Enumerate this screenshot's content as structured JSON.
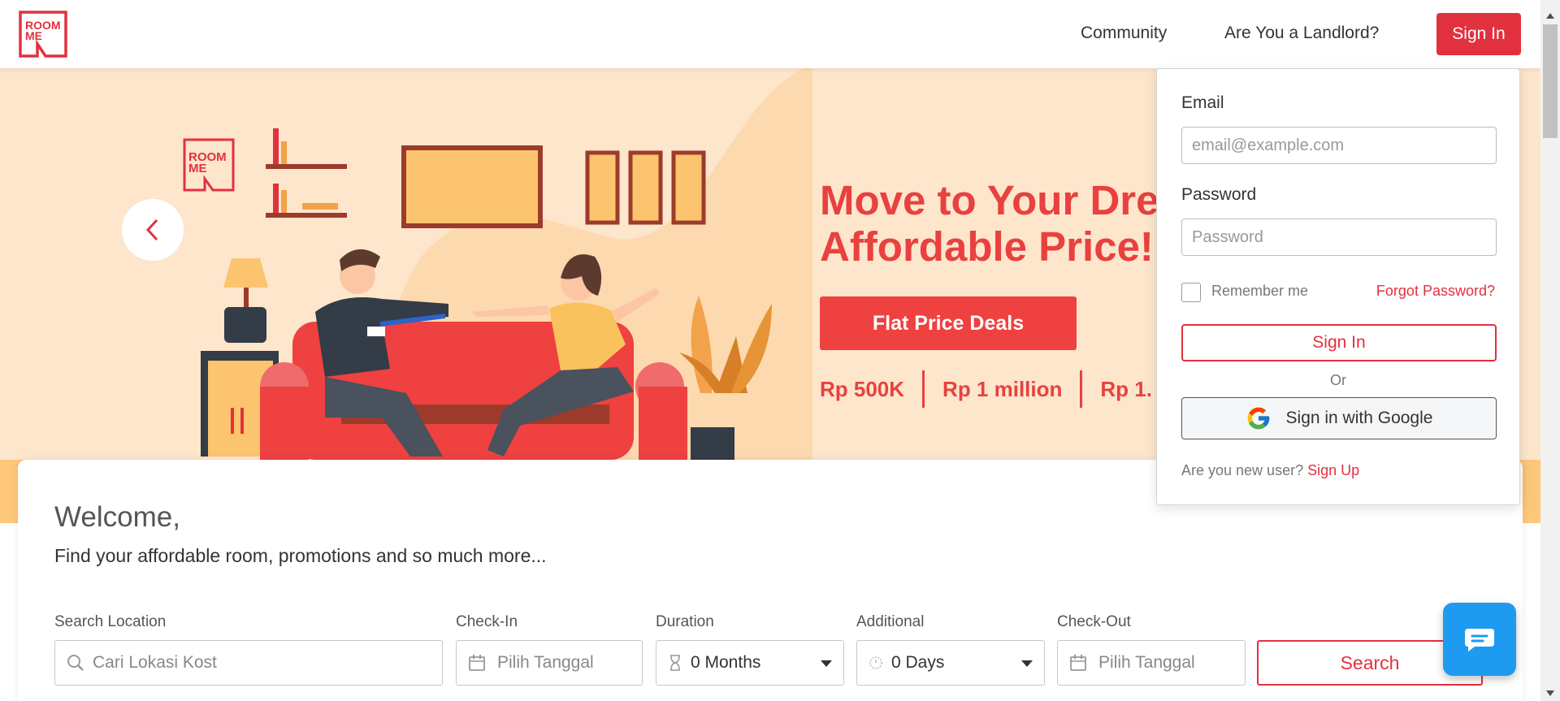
{
  "header": {
    "logo_line1": "ROOM",
    "logo_line2": "ME",
    "nav_community": "Community",
    "nav_landlord": "Are You a Landlord?",
    "signin_label": "Sign In"
  },
  "hero": {
    "title_line1": "Move to Your Dre",
    "title_line2": "Affordable Price!",
    "cta_label": "Flat Price Deals",
    "prices": [
      "Rp 500K",
      "Rp 1 million",
      "Rp 1."
    ],
    "brand_line1": "ROOM",
    "brand_line2": "ME"
  },
  "welcome": {
    "title": "Welcome,",
    "subtitle": "Find your affordable room, promotions and so much more..."
  },
  "search": {
    "location_label": "Search Location",
    "location_placeholder": "Cari Lokasi Kost",
    "checkin_label": "Check-In",
    "checkin_placeholder": "Pilih Tanggal",
    "duration_label": "Duration",
    "duration_value": "0 Months",
    "additional_label": "Additional",
    "additional_value": "0 Days",
    "checkout_label": "Check-Out",
    "checkout_placeholder": "Pilih Tanggal",
    "search_label": "Search"
  },
  "signin_panel": {
    "email_label": "Email",
    "email_placeholder": "email@example.com",
    "password_label": "Password",
    "password_placeholder": "Password",
    "remember_label": "Remember me",
    "forgot_label": "Forgot Password?",
    "signin_label": "Sign In",
    "or_label": "Or",
    "google_label": "Sign in with Google",
    "new_user_text": "Are you new user?",
    "signup_label": "Sign Up"
  },
  "colors": {
    "brand_red": "#e2313e",
    "hero_bg": "#fde6cc",
    "hero_bar": "#fdc77a",
    "chat_blue": "#1e9bf0"
  },
  "icons": [
    "chevron-left-icon",
    "search-icon",
    "calendar-icon",
    "hourglass-icon",
    "clock-icon",
    "caret-down-icon",
    "google-icon",
    "chat-icon"
  ]
}
